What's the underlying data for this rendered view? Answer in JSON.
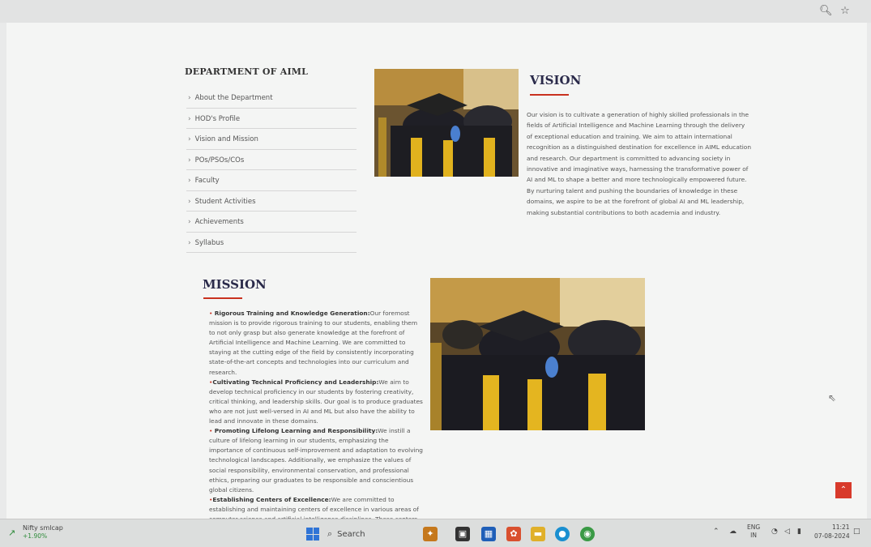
{
  "browser": {
    "zoom_icon": "magnifier-icon",
    "bookmark_icon": "star-icon"
  },
  "sidebar": {
    "title": "DEPARTMENT OF AIML",
    "items": [
      {
        "label": "About the Department"
      },
      {
        "label": "HOD's Profile"
      },
      {
        "label": "Vision and Mission"
      },
      {
        "label": "POs/PSOs/COs"
      },
      {
        "label": "Faculty"
      },
      {
        "label": "Student Activities"
      },
      {
        "label": "Achievements"
      },
      {
        "label": "Syllabus"
      }
    ]
  },
  "vision": {
    "title": "VISION",
    "text": "Our vision is to cultivate a generation of highly skilled professionals in the fields of Artificial Intelligence and Machine Learning through the delivery of exceptional education and training. We aim to attain international recognition as a distinguished destination for excellence in AIML education and research. Our department is committed to advancing society in innovative and imaginative ways, harnessing the transformative power of AI and ML to shape a better and more technologically empowered future. By nurturing talent and pushing the boundaries of knowledge in these domains, we aspire to be at the forefront of global AI and ML leadership, making substantial contributions to both academia and industry."
  },
  "mission": {
    "title": "MISSION",
    "items": [
      {
        "heading": "Rigorous Training and Knowledge Generation:",
        "text": "Our foremost mission is to provide rigorous training to our students, enabling them to not only grasp but also generate knowledge at the forefront of Artificial Intelligence and Machine Learning. We are committed to staying at the cutting edge of the field by consistently incorporating state-of-the-art concepts and technologies into our curriculum and research."
      },
      {
        "heading": "Cultivating Technical Proficiency and Leadership:",
        "text": "We aim to develop technical proficiency in our students by fostering creativity, critical thinking, and leadership skills. Our goal is to produce graduates who are not just well-versed in AI and ML but also have the ability to lead and innovate in these domains."
      },
      {
        "heading": "Promoting Lifelong Learning and Responsibility:",
        "text": "We instill a culture of lifelong learning in our students, emphasizing the importance of continuous self-improvement and adaptation to evolving technological landscapes. Additionally, we emphasize the values of social responsibility, environmental conservation, and professional ethics, preparing our graduates to be responsible and conscientious global citizens."
      },
      {
        "heading": "Establishing Centers of Excellence:",
        "text": "We are committed to establishing and maintaining centers of excellence in various areas of computer science and artificial intelligence disciplines. These centers will serve as"
      }
    ]
  },
  "taskbar": {
    "widget_name": "Nifty smlcap",
    "widget_change": "+1.90%",
    "search_placeholder": "Search",
    "lang_top": "ENG",
    "lang_bottom": "IN",
    "time": "11:21",
    "date": "07-08-2024"
  },
  "colors": {
    "accent": "#c9311f",
    "heading": "#2a2a4a"
  }
}
